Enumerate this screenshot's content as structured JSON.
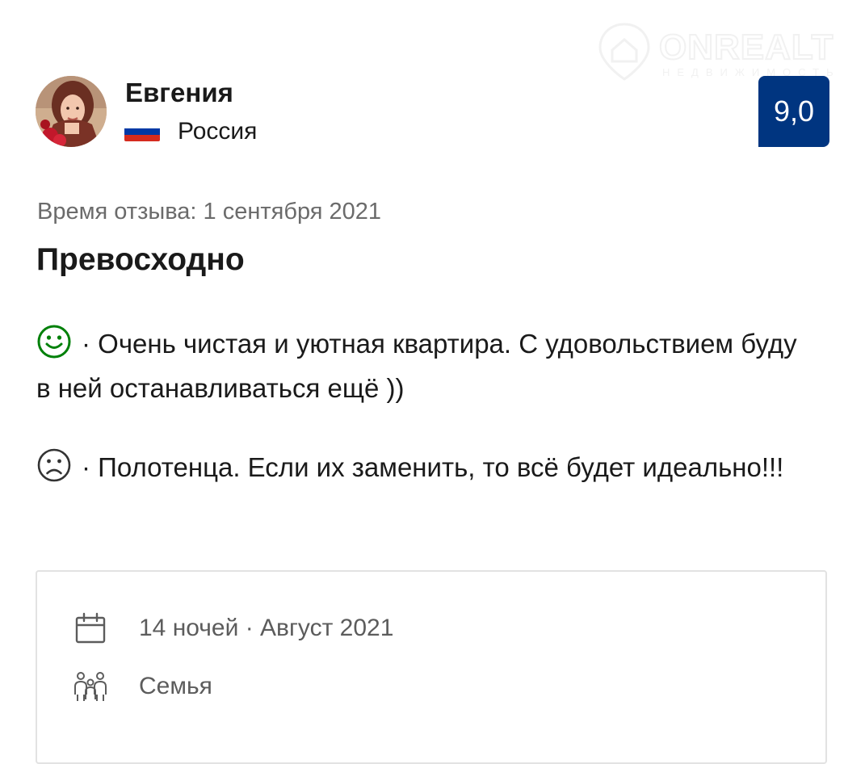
{
  "watermark": {
    "brand": "ONREALT",
    "subtitle": "НЕДВИЖИМОСТЬ"
  },
  "reviewer": {
    "name": "Евгения",
    "country": "Россия",
    "flag_colors": [
      "#ffffff",
      "#0039a6",
      "#d52b1e"
    ]
  },
  "score": {
    "value": "9,0",
    "color": "#003580"
  },
  "review": {
    "date_text": "Время отзыва: 1 сентября 2021",
    "title": "Превосходно",
    "positive": {
      "icon": "smile-icon",
      "text": "· Очень чистая и уютная квартира. С удовольствием буду в ней останавливаться ещё ))",
      "icon_color": "#008009"
    },
    "negative": {
      "icon": "frown-icon",
      "text": "· Полотенца. Если их заменить, то всё будет идеально!!!",
      "icon_color": "#333333"
    }
  },
  "stay": {
    "nights_text": "14 ночей · Август 2021",
    "traveler_type": "Семья",
    "icons": [
      "calendar-icon",
      "family-icon"
    ]
  }
}
